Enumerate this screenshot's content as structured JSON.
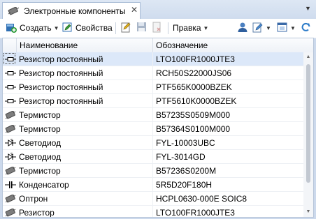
{
  "tab": {
    "title": "Электронные компоненты",
    "close": "✕",
    "overflow": "▼",
    "icon": "component-icon"
  },
  "toolbar": {
    "create_label": "Создать",
    "properties_label": "Свойства",
    "edit_label": "Правка"
  },
  "columns": {
    "name": "Наименование",
    "code": "Обозначение"
  },
  "rows": [
    {
      "name": "Резистор постоянный",
      "code": "LTO100FR1000JTE3",
      "icon": "resistor-icon",
      "selected": true
    },
    {
      "name": "Резистор постоянный",
      "code": "RCH50S22000JS06",
      "icon": "resistor-icon"
    },
    {
      "name": "Резистор постоянный",
      "code": "PTF565K0000BZEK",
      "icon": "resistor-icon"
    },
    {
      "name": "Резистор постоянный",
      "code": "PTF5610K0000BZEK",
      "icon": "resistor-icon"
    },
    {
      "name": "Термистор",
      "code": "B57235S0509M000",
      "icon": "component-icon"
    },
    {
      "name": "Термистор",
      "code": "B57364S0100M000",
      "icon": "component-icon"
    },
    {
      "name": "Светодиод",
      "code": "FYL-10003UBC",
      "icon": "led-icon"
    },
    {
      "name": "Светодиод",
      "code": "FYL-3014GD",
      "icon": "led-icon"
    },
    {
      "name": "Термистор",
      "code": "B57236S0200M",
      "icon": "component-icon"
    },
    {
      "name": "Конденсатор",
      "code": "5R5D20F180H",
      "icon": "capacitor-icon"
    },
    {
      "name": "Оптрон",
      "code": "HCPL0630-000E SOIC8",
      "icon": "component-icon"
    },
    {
      "name": "Резистор",
      "code": "LTO100FR1000JTE3",
      "icon": "component-icon"
    }
  ],
  "scrollbar": {
    "up": "▲",
    "down": "▼"
  }
}
